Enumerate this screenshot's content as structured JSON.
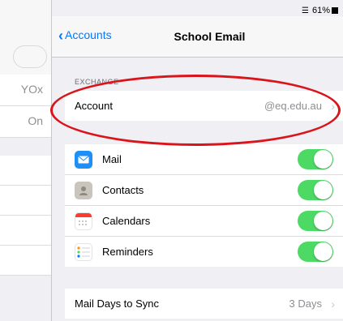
{
  "status_bar": {
    "battery": "61%"
  },
  "left_pane": {
    "items": [
      "YOx",
      "On"
    ]
  },
  "navbar": {
    "back_label": "Accounts",
    "title": "School Email"
  },
  "exchange": {
    "header": "EXCHANGE",
    "account_label": "Account",
    "account_value": "@eq.edu.au"
  },
  "sync": {
    "items": [
      {
        "label": "Mail",
        "icon": "mail-icon",
        "enabled": true
      },
      {
        "label": "Contacts",
        "icon": "contacts-icon",
        "enabled": true
      },
      {
        "label": "Calendars",
        "icon": "calendar-icon",
        "enabled": true
      },
      {
        "label": "Reminders",
        "icon": "reminders-icon",
        "enabled": true
      }
    ]
  },
  "mail_days": {
    "label": "Mail Days to Sync",
    "value": "3 Days"
  },
  "colors": {
    "toggle_on": "#4cd964",
    "accent": "#007aff",
    "annotation": "#d9151b"
  }
}
